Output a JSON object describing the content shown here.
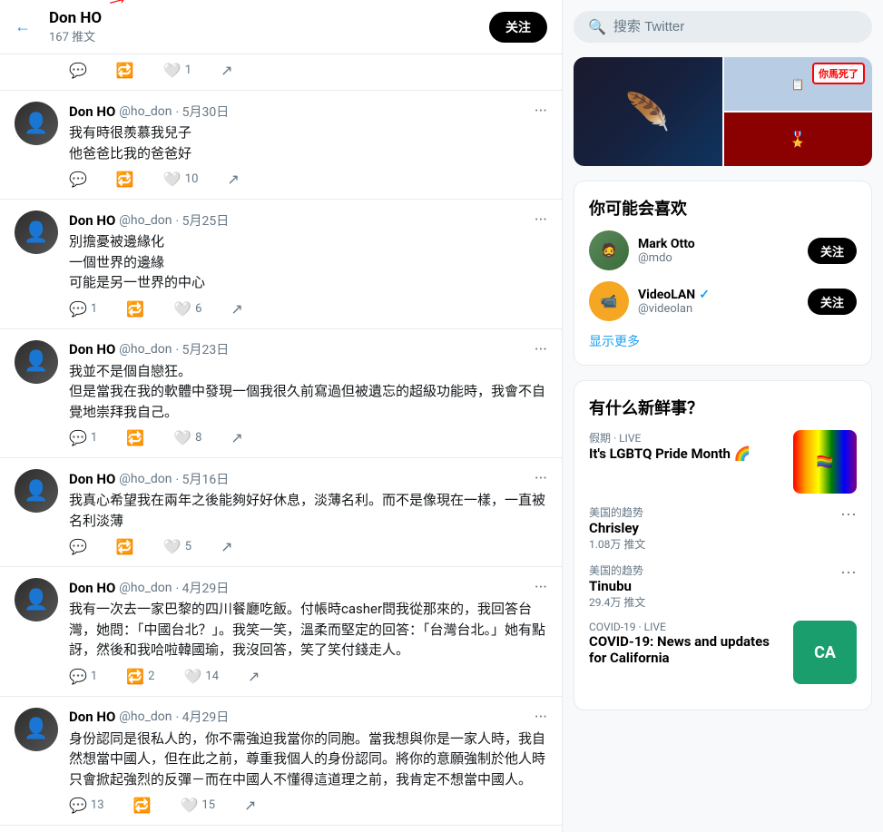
{
  "header": {
    "name": "Don HO",
    "sub": "167 推文",
    "follow_label": "关注",
    "back_icon": "←"
  },
  "search": {
    "placeholder": "搜索 Twitter"
  },
  "tweets": [
    {
      "id": "t0",
      "name": "Don HO",
      "handle": "@ho_don",
      "date": "5月30日",
      "text": "我有時很羨慕我兒子\n他爸爸比我的爸爸好",
      "reply_count": "",
      "retweet_count": "",
      "like_count": "10",
      "share": ""
    },
    {
      "id": "t1",
      "name": "Don HO",
      "handle": "@ho_don",
      "date": "5月25日",
      "text": "別擔憂被邊緣化\n一個世界的邊緣\n可能是另一世界的中心",
      "reply_count": "1",
      "retweet_count": "",
      "like_count": "6",
      "share": ""
    },
    {
      "id": "t2",
      "name": "Don HO",
      "handle": "@ho_don",
      "date": "5月23日",
      "text": "我並不是個自戀狂。\n但是當我在我的軟體中發現一個我很久前寫過但被遺忘的超級功能時，我會不自覺地崇拜我自己。",
      "reply_count": "1",
      "retweet_count": "",
      "like_count": "8",
      "share": ""
    },
    {
      "id": "t3",
      "name": "Don HO",
      "handle": "@ho_don",
      "date": "5月16日",
      "text": "我真心希望我在兩年之後能夠好好休息，淡薄名利。而不是像現在一樣，一直被名利淡薄",
      "reply_count": "",
      "retweet_count": "",
      "like_count": "5",
      "share": ""
    },
    {
      "id": "t4",
      "name": "Don HO",
      "handle": "@ho_don",
      "date": "4月29日",
      "text": "我有一次去一家巴黎的四川餐廳吃飯。付帳時casher問我從那來的，我回答台灣，她問：「中國台北？」。我笑一笑，溫柔而堅定的回答：「台灣台北。」她有點訝，然後和我哈啦韓國瑜，我沒回答，笑了笑付錢走人。",
      "reply_count": "1",
      "retweet_count": "2",
      "like_count": "14",
      "share": ""
    },
    {
      "id": "t5",
      "name": "Don HO",
      "handle": "@ho_don",
      "date": "4月29日",
      "text": "身份認同是很私人的，你不需強迫我當你的同胞。當我想與你是一家人時，我自然想當中國人，但在此之前，尊重我個人的身份認同。將你的意願強制於他人時只會掀起強烈的反彈－而在中國人不懂得這道理之前，我肯定不想當中國人。",
      "reply_count": "13",
      "retweet_count": "",
      "like_count": "15",
      "share": ""
    }
  ],
  "actions_bar": {
    "reply_count": "",
    "retweet_count": "",
    "like_count": "1",
    "share": ""
  },
  "suggestions": {
    "title": "你可能会喜欢",
    "items": [
      {
        "name": "Mark Otto",
        "handle": "@mdo",
        "verified": false,
        "follow_label": "关注"
      },
      {
        "name": "VideoLAN",
        "handle": "@videolan",
        "verified": true,
        "follow_label": "关注"
      }
    ],
    "show_more": "显示更多"
  },
  "whats_happening": {
    "title": "有什么新鲜事？",
    "items": [
      {
        "category": "假期 · LIVE",
        "name": "It's LGBTQ Pride Month 🌈",
        "count": "",
        "has_image": true,
        "image_type": "lgbtq"
      },
      {
        "category": "美国的趋势",
        "name": "Chrisley",
        "count": "1.08万 推文",
        "has_image": false
      },
      {
        "category": "美国的趋势",
        "name": "Tinubu",
        "count": "29.4万 推文",
        "has_image": false
      },
      {
        "category": "COVID-19 · LIVE",
        "name": "COVID-19: News and updates for California",
        "count": "",
        "has_image": true,
        "image_type": "ca"
      }
    ]
  },
  "trending_image_overlay": "你馬死了"
}
